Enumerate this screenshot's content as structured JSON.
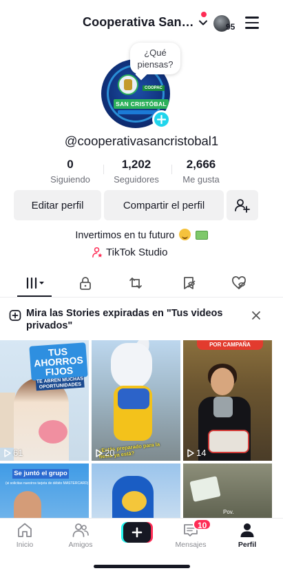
{
  "header": {
    "account_name": "Cooperativa San…",
    "streak_count": "95"
  },
  "avatar": {
    "bubble_line1": "¿Qué",
    "bubble_line2": "piensas?",
    "logo_band_text": "SAN CRISTÓBAL",
    "logo_coopac_text": "COOPAC"
  },
  "profile": {
    "username": "@cooperativasancristobal1",
    "bio": "Invertimos en tu futuro",
    "studio_label": "TikTok Studio"
  },
  "stats": [
    {
      "value": "0",
      "label": "Siguiendo"
    },
    {
      "value": "1,202",
      "label": "Seguidores"
    },
    {
      "value": "2,666",
      "label": "Me gusta"
    }
  ],
  "actions": {
    "edit_label": "Editar perfil",
    "share_label": "Compartir el perfil"
  },
  "tabs": [
    {
      "name": "videos",
      "icon": "grid-icon",
      "active": true
    },
    {
      "name": "private",
      "icon": "lock-icon"
    },
    {
      "name": "reposts",
      "icon": "repost-icon"
    },
    {
      "name": "favorites",
      "icon": "bookmark-eye-icon"
    },
    {
      "name": "liked",
      "icon": "heart-eye-icon"
    }
  ],
  "banner": {
    "text": "Mira las Stories expiradas en \"Tus videos privados\""
  },
  "videos": [
    {
      "views": "61",
      "sign_title": "TUS AHORROS FIJOS",
      "sign_sub": "TE ABREN MUCHAS OPORTUNIDADES"
    },
    {
      "views": "20",
      "caption": "¿Estás preparado para la fiesta ya está?"
    },
    {
      "views": "14",
      "banner": "POR CAMPAÑA"
    },
    {
      "label": "Se juntó el grupo",
      "sub": "(si solicitas nuestros tarjeta de débito MASTERCARD)"
    },
    {},
    {
      "tag": "Pov."
    }
  ],
  "bottom_nav": {
    "home": "Inicio",
    "friends": "Amigos",
    "inbox": "Mensajes",
    "inbox_badge": "10",
    "profile": "Perfil"
  },
  "colors": {
    "accent_red": "#fe2c55",
    "accent_cyan": "#25f4ee",
    "text_dark": "#161823"
  }
}
